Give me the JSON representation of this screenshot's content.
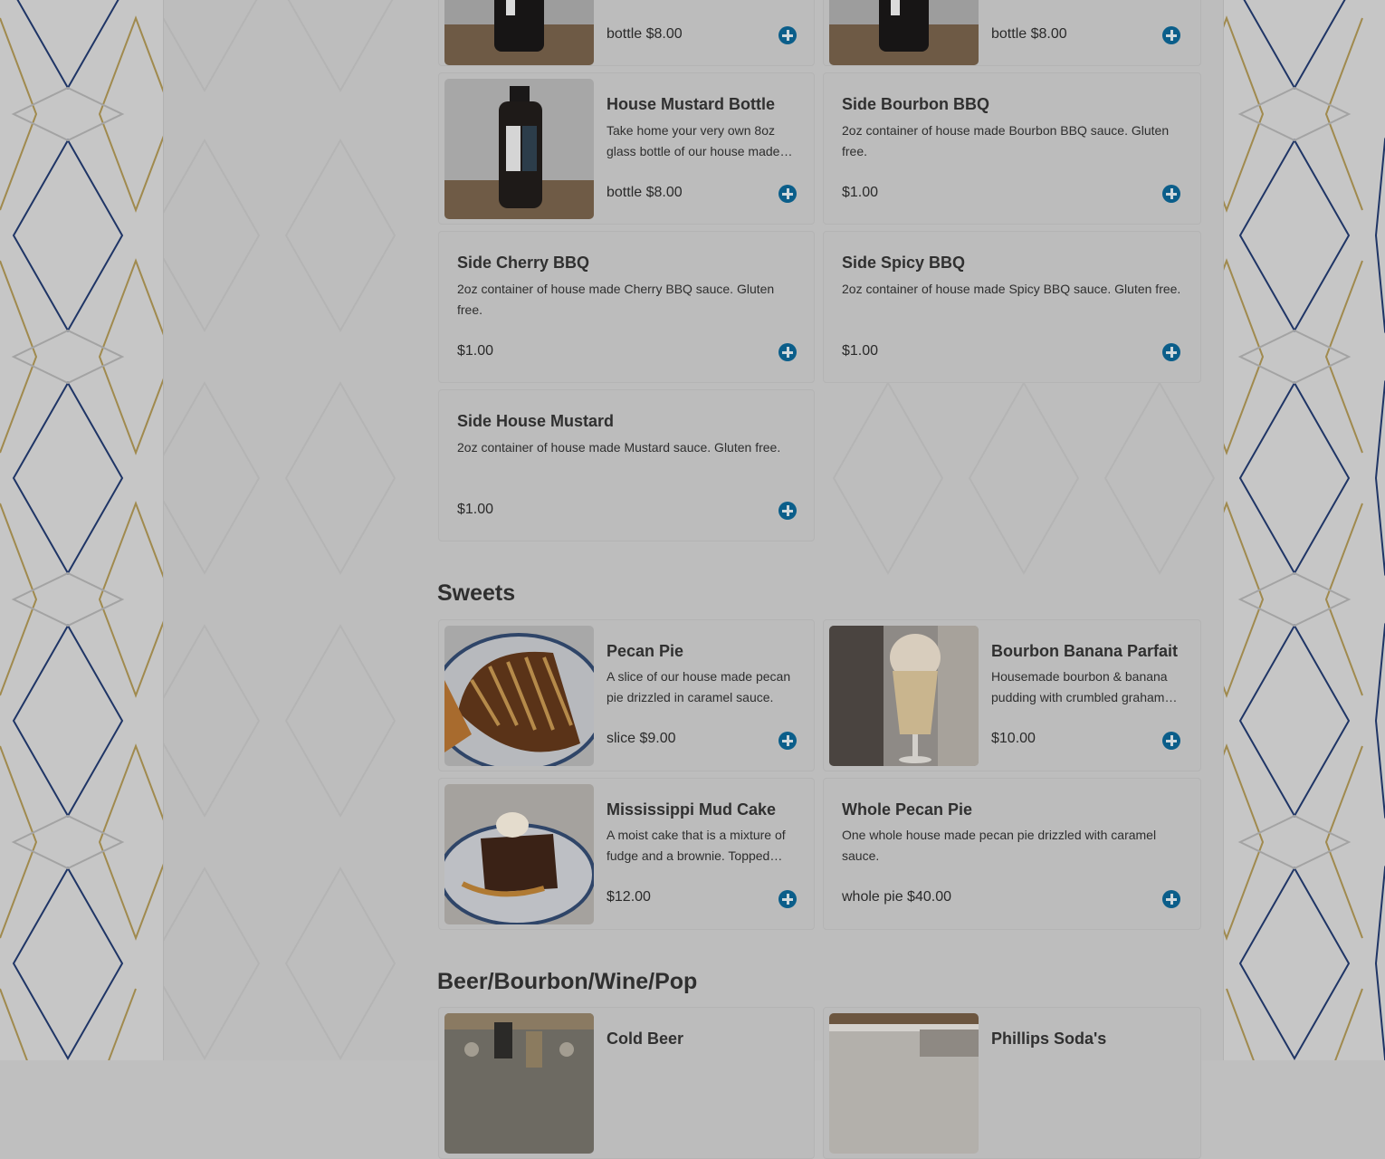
{
  "colors": {
    "accent": "#0b5e8a",
    "text": "#2f2f2f",
    "overlay": "#bcbcbc"
  },
  "sauces": {
    "items": [
      {
        "title": "",
        "desc": "",
        "price": "bottle $8.00"
      },
      {
        "title": "",
        "desc": "",
        "price": "bottle $8.00"
      },
      {
        "title": "House Mustard Bottle",
        "desc": "Take home your very own 8oz glass bottle of our house made…",
        "price": "bottle $8.00"
      },
      {
        "title": "Side Bourbon BBQ",
        "desc": "2oz container of house made Bourbon BBQ sauce. Gluten free.",
        "price": "$1.00"
      },
      {
        "title": "Side Cherry BBQ",
        "desc": "2oz container of house made Cherry BBQ sauce. Gluten free.",
        "price": "$1.00"
      },
      {
        "title": "Side Spicy BBQ",
        "desc": "2oz container of house made Spicy BBQ sauce. Gluten free.",
        "price": "$1.00"
      },
      {
        "title": "Side House Mustard",
        "desc": "2oz container of house made Mustard sauce. Gluten free.",
        "price": "$1.00"
      }
    ]
  },
  "sweets": {
    "heading": "Sweets",
    "items": [
      {
        "title": "Pecan Pie",
        "desc": "A slice of our house made pecan pie drizzled in caramel sauce.",
        "price": "slice $9.00"
      },
      {
        "title": "Bourbon Banana Parfait",
        "desc": "Housemade bourbon & banana pudding with crumbled graham…",
        "price": "$10.00"
      },
      {
        "title": "Mississippi Mud Cake",
        "desc": "A moist cake that is a mixture of fudge and a brownie. Topped…",
        "price": "$12.00"
      },
      {
        "title": "Whole Pecan Pie",
        "desc": "One whole house made pecan pie drizzled with caramel sauce.",
        "price": "whole pie $40.00"
      }
    ]
  },
  "drinks": {
    "heading": "Beer/Bourbon/Wine/Pop",
    "items": [
      {
        "title": "Cold Beer"
      },
      {
        "title": "Phillips Soda's"
      }
    ]
  },
  "icons": {
    "add": "plus-circle-icon"
  }
}
